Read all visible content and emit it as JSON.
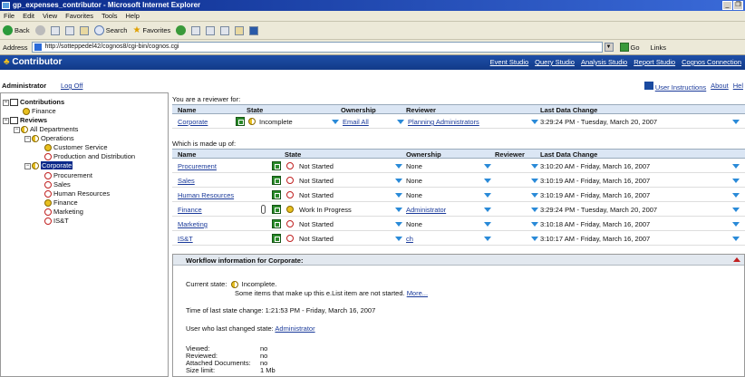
{
  "window": {
    "title": "gp_expenses_contributor - Microsoft Internet Explorer",
    "buttons": [
      "_",
      "❐"
    ]
  },
  "menu": [
    "File",
    "Edit",
    "View",
    "Favorites",
    "Tools",
    "Help"
  ],
  "toolbar": {
    "back": "Back",
    "search": "Search",
    "favorites": "Favorites"
  },
  "address": {
    "label": "Address",
    "url": "http://sotteppedel42/cognos8/cgi-bin/cognos.cgi",
    "go": "Go",
    "links": "Links"
  },
  "app": {
    "title": "Contributor",
    "studios": [
      "Event Studio",
      "Query Studio",
      "Analysis Studio",
      "Report Studio",
      "Cognos Connection"
    ]
  },
  "user": {
    "name": "Administrator",
    "logoff": "Log Off",
    "instructions": "User Instructions",
    "about": "About",
    "help": "Hel"
  },
  "tree": {
    "contributions": "Contributions",
    "finance": "Finance",
    "reviews": "Reviews",
    "all_departments": "All Departments",
    "operations": "Operations",
    "customer_service": "Customer Service",
    "production": "Production and Distribution",
    "corporate": "Corporate",
    "procurement": "Procurement",
    "sales": "Sales",
    "human_resources": "Human Resources",
    "finance2": "Finance",
    "marketing": "Marketing",
    "isst": "IS&T"
  },
  "reviewer_section": {
    "caption": "You are a reviewer for:",
    "headers": {
      "name": "Name",
      "state": "State",
      "ownership": "Ownership",
      "reviewer": "Reviewer",
      "last_change": "Last Data Change"
    },
    "row": {
      "name": "Corporate",
      "state": "Incomplete",
      "ownership": "Email All",
      "reviewer": "Planning Administrators",
      "last_change": "3:29:24 PM - Tuesday, March 20, 2007"
    }
  },
  "made_up_section": {
    "caption": "Which is made up of:",
    "headers": {
      "name": "Name",
      "state": "State",
      "ownership": "Ownership",
      "reviewer": "Reviewer",
      "last_change": "Last Data Change"
    },
    "rows": [
      {
        "name": "Procurement",
        "state": "Not Started",
        "ownership": "None",
        "last_change": "3:10:20 AM - Friday, March 16, 2007"
      },
      {
        "name": "Sales",
        "state": "Not Started",
        "ownership": "None",
        "last_change": "3:10:19 AM - Friday, March 16, 2007"
      },
      {
        "name": "Human Resources",
        "state": "Not Started",
        "ownership": "None",
        "last_change": "3:10:19 AM - Friday, March 16, 2007"
      },
      {
        "name": "Finance",
        "state": "Work In Progress",
        "ownership": "Administrator",
        "last_change": "3:29:24 PM - Tuesday, March 20, 2007"
      },
      {
        "name": "Marketing",
        "state": "Not Started",
        "ownership": "None",
        "last_change": "3:10:18 AM - Friday, March 16, 2007"
      },
      {
        "name": "IS&T",
        "state": "Not Started",
        "ownership": "ch",
        "last_change": "3:10:17 AM - Friday, March 16, 2007"
      }
    ]
  },
  "workflow": {
    "title": "Workflow information for Corporate:",
    "current_state_label": "Current state:",
    "current_state": "Incomplete.",
    "current_state_detail": "Some items that make up this e.List item are not started.",
    "more": "More...",
    "time_label": "Time of last state change: 1:21:53 PM - Friday, March 16, 2007",
    "user_label": "User who last changed state:",
    "user": "Administrator",
    "viewed_label": "Viewed:",
    "viewed": "no",
    "reviewed_label": "Reviewed:",
    "reviewed": "no",
    "attached_label": "Attached Documents:",
    "attached": "no",
    "size_label": "Size limit:",
    "size": "1 Mb"
  }
}
